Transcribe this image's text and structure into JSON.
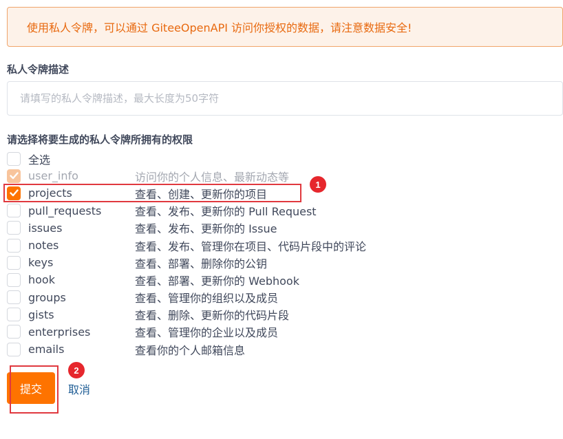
{
  "alert": {
    "text": "使用私人令牌，可以通过 GiteeOpenAPI 访问你授权的数据，请注意数据安全!"
  },
  "description": {
    "label": "私人令牌描述",
    "placeholder": "请填写的私人令牌描述，最大长度为50字符",
    "value": ""
  },
  "permissions": {
    "label": "请选择将要生成的私人令牌所拥有的权限",
    "select_all_label": "全选",
    "select_all_checked": false,
    "items": [
      {
        "name": "user_info",
        "desc": "访问你的个人信息、最新动态等",
        "checked": true,
        "disabled": true
      },
      {
        "name": "projects",
        "desc": "查看、创建、更新你的项目",
        "checked": true,
        "disabled": false
      },
      {
        "name": "pull_requests",
        "desc": "查看、发布、更新你的 Pull Request",
        "checked": false,
        "disabled": false
      },
      {
        "name": "issues",
        "desc": "查看、发布、更新你的 Issue",
        "checked": false,
        "disabled": false
      },
      {
        "name": "notes",
        "desc": "查看、发布、管理你在项目、代码片段中的评论",
        "checked": false,
        "disabled": false
      },
      {
        "name": "keys",
        "desc": "查看、部署、删除你的公钥",
        "checked": false,
        "disabled": false
      },
      {
        "name": "hook",
        "desc": "查看、部署、更新你的 Webhook",
        "checked": false,
        "disabled": false
      },
      {
        "name": "groups",
        "desc": "查看、管理你的组织以及成员",
        "checked": false,
        "disabled": false
      },
      {
        "name": "gists",
        "desc": "查看、删除、更新你的代码片段",
        "checked": false,
        "disabled": false
      },
      {
        "name": "enterprises",
        "desc": "查看、管理你的企业以及成员",
        "checked": false,
        "disabled": false
      },
      {
        "name": "emails",
        "desc": "查看你的个人邮箱信息",
        "checked": false,
        "disabled": false
      }
    ]
  },
  "actions": {
    "submit_label": "提交",
    "cancel_label": "取消"
  },
  "annotations": {
    "marker_1": "1",
    "marker_2": "2"
  },
  "colors": {
    "accent": "#fe7300",
    "accent_disabled": "#f8c49c",
    "alert_text": "#e8690f",
    "alert_bg": "#fdf2e9",
    "highlight": "#e0383e",
    "link": "#1f5d95"
  }
}
